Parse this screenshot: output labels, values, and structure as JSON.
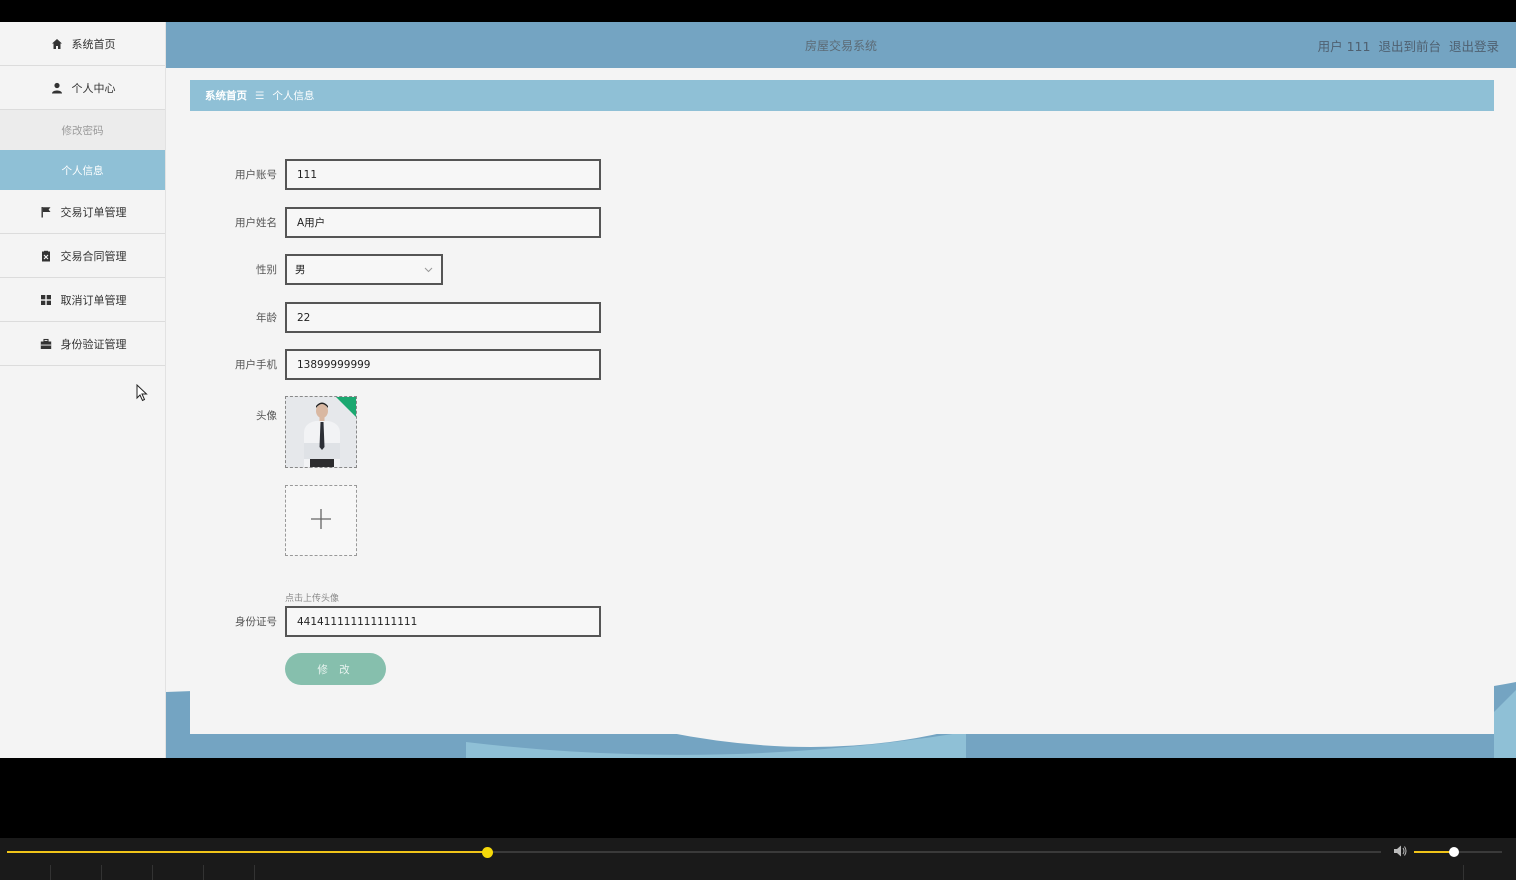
{
  "app": {
    "title": "房屋交易系统",
    "user_label": "用户 111",
    "to_frontend": "退出到前台",
    "logout": "退出登录"
  },
  "sidebar": {
    "items": [
      {
        "label": "系统首页",
        "icon": "home-icon"
      },
      {
        "label": "个人中心",
        "icon": "user-icon"
      },
      {
        "label": "交易订单管理",
        "icon": "flag-icon"
      },
      {
        "label": "交易合同管理",
        "icon": "clipboard-icon"
      },
      {
        "label": "取消订单管理",
        "icon": "grid-icon"
      },
      {
        "label": "身份验证管理",
        "icon": "briefcase-icon"
      }
    ],
    "sub_items": [
      {
        "label": "修改密码",
        "active": false
      },
      {
        "label": "个人信息",
        "active": true
      }
    ]
  },
  "breadcrumb": {
    "home": "系统首页",
    "separator": "☰",
    "current": "个人信息"
  },
  "form": {
    "account_label": "用户账号",
    "account_value": "111",
    "name_label": "用户姓名",
    "name_value": "A用户",
    "gender_label": "性别",
    "gender_value": "男",
    "age_label": "年龄",
    "age_value": "22",
    "phone_label": "用户手机",
    "phone_value": "13899999999",
    "avatar_label": "头像",
    "upload_hint": "点击上传头像",
    "idcard_label": "身份证号",
    "idcard_value": "441411111111111111",
    "submit_label": "修 改"
  },
  "player": {
    "progress": 0.35,
    "volume": 0.45
  },
  "colors": {
    "header": "#74a4c2",
    "accent": "#8fc0d6",
    "button": "#86bfad",
    "progress": "#f0c419"
  }
}
